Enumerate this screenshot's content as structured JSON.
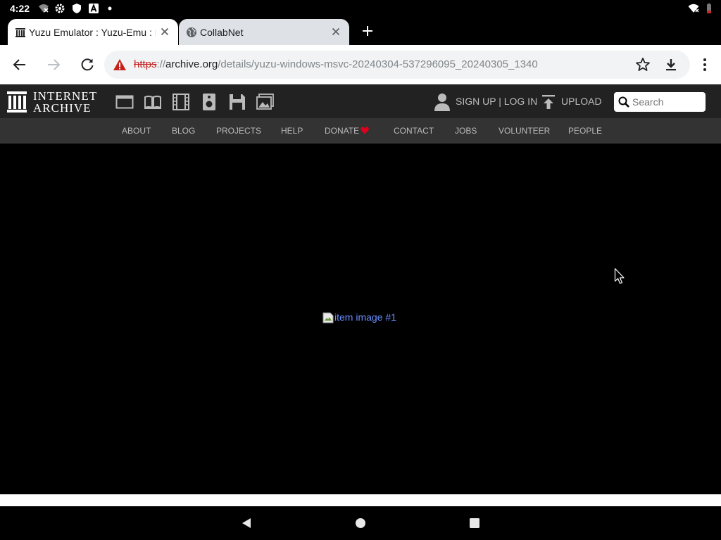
{
  "status_bar": {
    "time": "4:22",
    "icons": [
      "signal-off-icon",
      "gear-icon",
      "shield-icon",
      "a-icon",
      "dot-icon",
      "wifi-icon",
      "battery-icon"
    ]
  },
  "tabs": [
    {
      "title": "Yuzu Emulator : Yuzu-Emu : F",
      "favicon": "internet-archive-icon",
      "active": true
    },
    {
      "title": "CollabNet",
      "favicon": "globe-icon",
      "active": false
    }
  ],
  "toolbar": {
    "url_scheme": "https",
    "url_sep": "://",
    "url_host": "archive.org",
    "url_path": "/details/yuzu-windows-msvc-20240304-537296095_20240305_1340"
  },
  "ia_header": {
    "logo_line1": "INTERNET",
    "logo_line2": "ARCHIVE",
    "media_icons": [
      "web-icon",
      "texts-icon",
      "video-icon",
      "audio-icon",
      "software-icon",
      "images-icon"
    ],
    "signup_login": "SIGN UP | LOG IN",
    "upload": "UPLOAD",
    "search_placeholder": "Search"
  },
  "nav": [
    "ABOUT",
    "BLOG",
    "PROJECTS",
    "HELP",
    "DONATE",
    "CONTACT",
    "JOBS",
    "VOLUNTEER",
    "PEOPLE"
  ],
  "content": {
    "image_alt": "item image #1"
  },
  "colors": {
    "accent_link": "#6a8dff",
    "donate_heart": "#e0001b",
    "header_bg": "#222222",
    "nav_bg": "#333333"
  }
}
